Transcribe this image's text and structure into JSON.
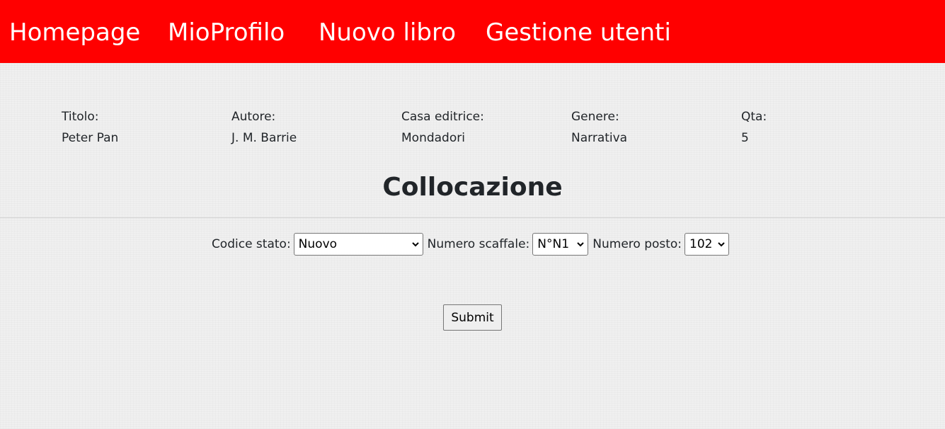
{
  "nav": {
    "items": [
      {
        "label": "Homepage"
      },
      {
        "label": "MioProfilo"
      },
      {
        "label": "Nuovo libro"
      },
      {
        "label": "Gestione utenti"
      }
    ]
  },
  "book": {
    "fields": [
      {
        "label": "Titolo:",
        "value": "Peter Pan"
      },
      {
        "label": "Autore:",
        "value": "J. M. Barrie"
      },
      {
        "label": "Casa editrice:",
        "value": "Mondadori"
      },
      {
        "label": "Genere:",
        "value": "Narrativa"
      },
      {
        "label": "Qta:",
        "value": "5"
      }
    ]
  },
  "collocazione": {
    "title": "Collocazione",
    "codice_stato": {
      "label": "Codice stato:",
      "selected": "Nuovo"
    },
    "numero_scaffale": {
      "label": "Numero scaffale:",
      "selected": "N°N1"
    },
    "numero_posto": {
      "label": "Numero posto:",
      "selected": "102"
    },
    "submit_label": "Submit"
  },
  "colors": {
    "navbar_bg": "#ff0000",
    "nav_text": "#ffffff",
    "page_bg": "#f0f0f0"
  }
}
